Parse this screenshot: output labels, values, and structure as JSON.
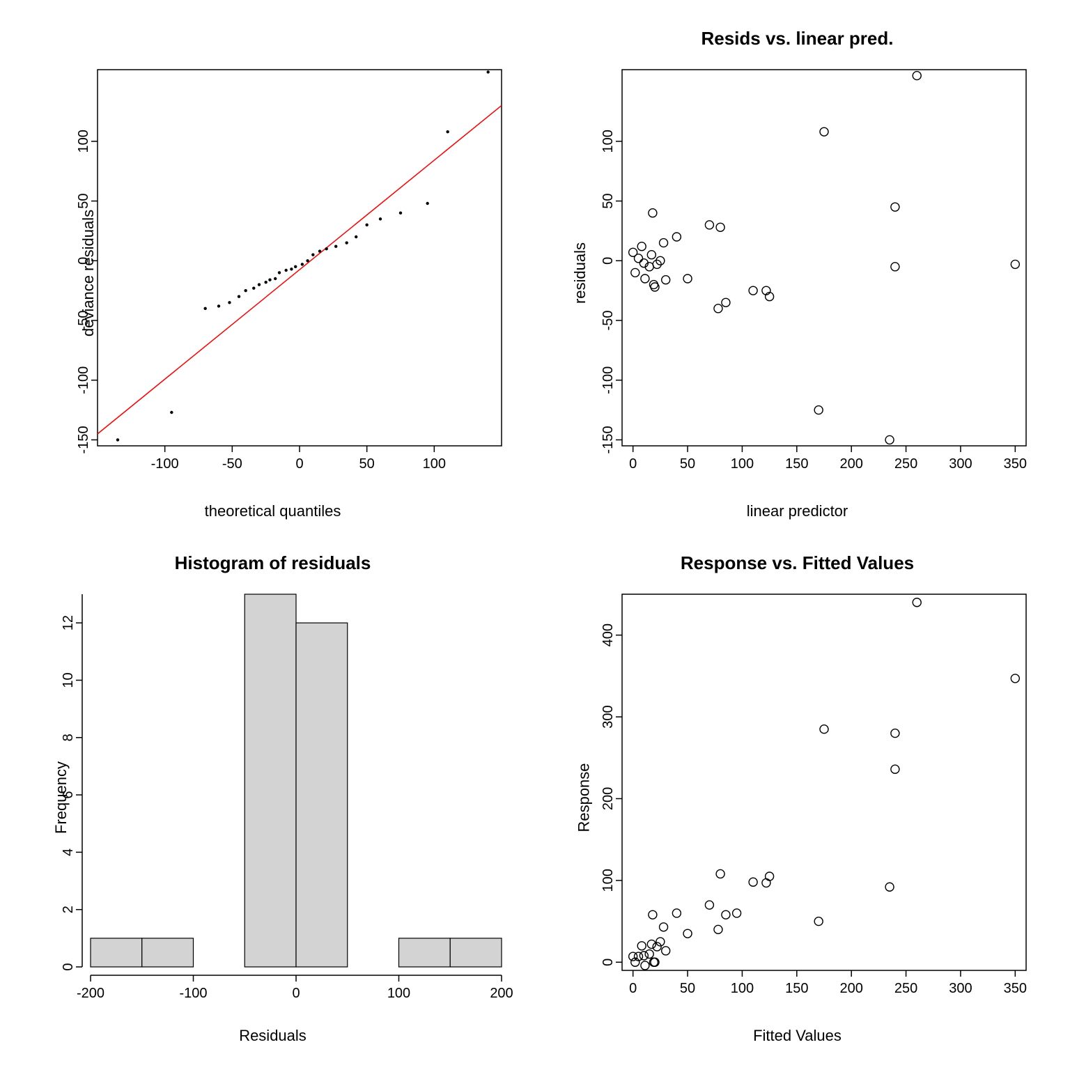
{
  "panels": {
    "qq": {
      "title": "",
      "xlabel": "theoretical quantiles",
      "ylabel": "deviance residuals"
    },
    "resid_vs_pred": {
      "title": "Resids vs. linear pred.",
      "xlabel": "linear predictor",
      "ylabel": "residuals"
    },
    "hist": {
      "title": "Histogram of residuals",
      "xlabel": "Residuals",
      "ylabel": "Frequency"
    },
    "resp_vs_fit": {
      "title": "Response vs. Fitted Values",
      "xlabel": "Fitted Values",
      "ylabel": "Response"
    }
  },
  "chart_data": [
    {
      "id": "qq",
      "type": "scatter",
      "title": "",
      "xlabel": "theoretical quantiles",
      "ylabel": "deviance residuals",
      "xlim": [
        -150,
        150
      ],
      "ylim": [
        -155,
        160
      ],
      "xticks": [
        -100,
        -50,
        0,
        50,
        100
      ],
      "yticks": [
        -150,
        -100,
        -50,
        0,
        50,
        100
      ],
      "reference_line": {
        "x1": -150,
        "y1": -145,
        "x2": 150,
        "y2": 130,
        "color": "red"
      },
      "points": [
        {
          "x": -135,
          "y": -150
        },
        {
          "x": -95,
          "y": -127
        },
        {
          "x": -70,
          "y": -40
        },
        {
          "x": -60,
          "y": -38
        },
        {
          "x": -52,
          "y": -35
        },
        {
          "x": -45,
          "y": -30
        },
        {
          "x": -40,
          "y": -25
        },
        {
          "x": -34,
          "y": -23
        },
        {
          "x": -30,
          "y": -20
        },
        {
          "x": -25,
          "y": -18
        },
        {
          "x": -22,
          "y": -16
        },
        {
          "x": -18,
          "y": -15
        },
        {
          "x": -15,
          "y": -10
        },
        {
          "x": -10,
          "y": -8
        },
        {
          "x": -6,
          "y": -7
        },
        {
          "x": -3,
          "y": -5
        },
        {
          "x": 2,
          "y": -3
        },
        {
          "x": 6,
          "y": 0
        },
        {
          "x": 10,
          "y": 5
        },
        {
          "x": 15,
          "y": 8
        },
        {
          "x": 20,
          "y": 10
        },
        {
          "x": 27,
          "y": 12
        },
        {
          "x": 35,
          "y": 15
        },
        {
          "x": 42,
          "y": 20
        },
        {
          "x": 50,
          "y": 30
        },
        {
          "x": 60,
          "y": 35
        },
        {
          "x": 75,
          "y": 40
        },
        {
          "x": 95,
          "y": 48
        },
        {
          "x": 110,
          "y": 108
        },
        {
          "x": 140,
          "y": 158
        }
      ]
    },
    {
      "id": "resid_vs_pred",
      "type": "scatter",
      "title": "Resids vs. linear pred.",
      "xlabel": "linear predictor",
      "ylabel": "residuals",
      "xlim": [
        -10,
        360
      ],
      "ylim": [
        -155,
        160
      ],
      "xticks": [
        0,
        50,
        100,
        150,
        200,
        250,
        300,
        350
      ],
      "yticks": [
        -150,
        -100,
        -50,
        0,
        50,
        100
      ],
      "points": [
        {
          "x": 0,
          "y": 7
        },
        {
          "x": 2,
          "y": -10
        },
        {
          "x": 5,
          "y": 2
        },
        {
          "x": 8,
          "y": 12
        },
        {
          "x": 10,
          "y": -2
        },
        {
          "x": 11,
          "y": -15
        },
        {
          "x": 15,
          "y": -5
        },
        {
          "x": 17,
          "y": 5
        },
        {
          "x": 18,
          "y": 40
        },
        {
          "x": 19,
          "y": -20
        },
        {
          "x": 20,
          "y": -22
        },
        {
          "x": 22,
          "y": -3
        },
        {
          "x": 25,
          "y": 0
        },
        {
          "x": 28,
          "y": 15
        },
        {
          "x": 30,
          "y": -16
        },
        {
          "x": 40,
          "y": 20
        },
        {
          "x": 50,
          "y": -15
        },
        {
          "x": 70,
          "y": 30
        },
        {
          "x": 78,
          "y": -40
        },
        {
          "x": 80,
          "y": 28
        },
        {
          "x": 85,
          "y": -35
        },
        {
          "x": 110,
          "y": -25
        },
        {
          "x": 122,
          "y": -25
        },
        {
          "x": 125,
          "y": -30
        },
        {
          "x": 170,
          "y": -125
        },
        {
          "x": 175,
          "y": 108
        },
        {
          "x": 235,
          "y": -150
        },
        {
          "x": 240,
          "y": -5
        },
        {
          "x": 240,
          "y": 45
        },
        {
          "x": 260,
          "y": 155
        },
        {
          "x": 350,
          "y": -3
        }
      ]
    },
    {
      "id": "hist",
      "type": "bar",
      "title": "Histogram of residuals",
      "xlabel": "Residuals",
      "ylabel": "Frequency",
      "xlim": [
        -200,
        200
      ],
      "ylim": [
        0,
        13
      ],
      "xticks": [
        -200,
        -100,
        0,
        100,
        200
      ],
      "yticks": [
        0,
        2,
        4,
        6,
        8,
        10,
        12
      ],
      "bin_width": 50,
      "categories": [
        -200,
        -150,
        -100,
        -50,
        0,
        50,
        100,
        150
      ],
      "values": [
        1,
        1,
        0,
        13,
        12,
        0,
        1,
        1
      ]
    },
    {
      "id": "resp_vs_fit",
      "type": "scatter",
      "title": "Response vs. Fitted Values",
      "xlabel": "Fitted Values",
      "ylabel": "Response",
      "xlim": [
        -10,
        360
      ],
      "ylim": [
        -10,
        450
      ],
      "xticks": [
        0,
        50,
        100,
        150,
        200,
        250,
        300,
        350
      ],
      "yticks": [
        0,
        100,
        200,
        300,
        400
      ],
      "points": [
        {
          "x": 0,
          "y": 7
        },
        {
          "x": 2,
          "y": 0
        },
        {
          "x": 5,
          "y": 7
        },
        {
          "x": 8,
          "y": 20
        },
        {
          "x": 10,
          "y": 8
        },
        {
          "x": 11,
          "y": -4
        },
        {
          "x": 15,
          "y": 10
        },
        {
          "x": 17,
          "y": 22
        },
        {
          "x": 18,
          "y": 58
        },
        {
          "x": 19,
          "y": 0
        },
        {
          "x": 20,
          "y": 0
        },
        {
          "x": 22,
          "y": 19
        },
        {
          "x": 25,
          "y": 25
        },
        {
          "x": 28,
          "y": 43
        },
        {
          "x": 30,
          "y": 14
        },
        {
          "x": 40,
          "y": 60
        },
        {
          "x": 50,
          "y": 35
        },
        {
          "x": 70,
          "y": 70
        },
        {
          "x": 78,
          "y": 40
        },
        {
          "x": 80,
          "y": 108
        },
        {
          "x": 85,
          "y": 58
        },
        {
          "x": 95,
          "y": 60
        },
        {
          "x": 110,
          "y": 98
        },
        {
          "x": 122,
          "y": 97
        },
        {
          "x": 125,
          "y": 105
        },
        {
          "x": 170,
          "y": 50
        },
        {
          "x": 175,
          "y": 285
        },
        {
          "x": 235,
          "y": 92
        },
        {
          "x": 240,
          "y": 236
        },
        {
          "x": 240,
          "y": 280
        },
        {
          "x": 260,
          "y": 440
        },
        {
          "x": 350,
          "y": 347
        }
      ]
    }
  ]
}
